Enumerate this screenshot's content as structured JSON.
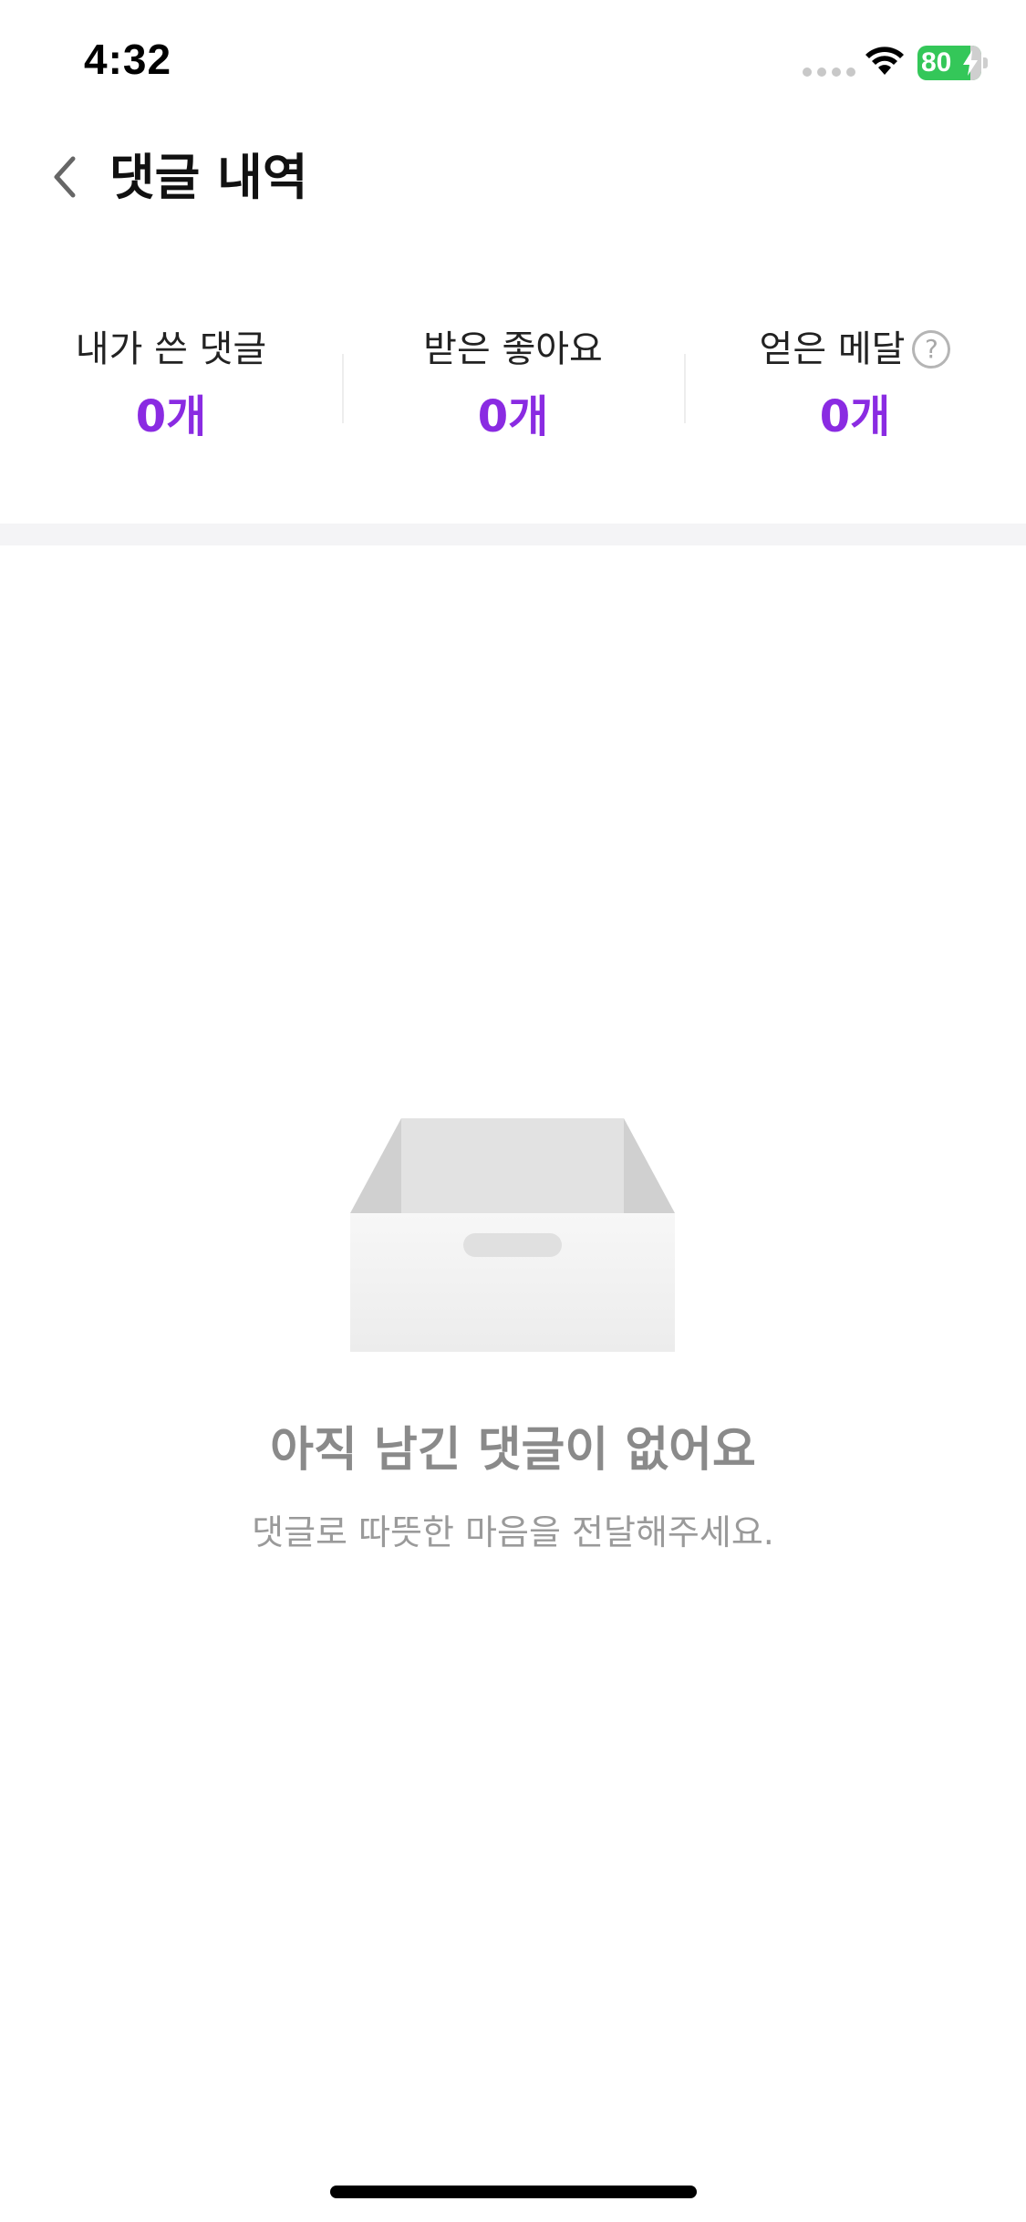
{
  "status_bar": {
    "time": "4:32",
    "battery_level": "80",
    "battery_color": "#34c759"
  },
  "nav": {
    "title": "댓글 내역",
    "back_icon": "chevron-left-icon"
  },
  "stats": {
    "items": [
      {
        "label": "내가 쓴 댓글",
        "value": "0개"
      },
      {
        "label": "받은 좋아요",
        "value": "0개"
      },
      {
        "label": "얻은 메달",
        "value": "0개",
        "help": "?"
      }
    ],
    "accent_color": "#8a2be2"
  },
  "empty_state": {
    "icon": "empty-box-icon",
    "title": "아직 남긴 댓글이 없어요",
    "subtitle": "댓글로 따뜻한 마음을 전달해주세요."
  }
}
